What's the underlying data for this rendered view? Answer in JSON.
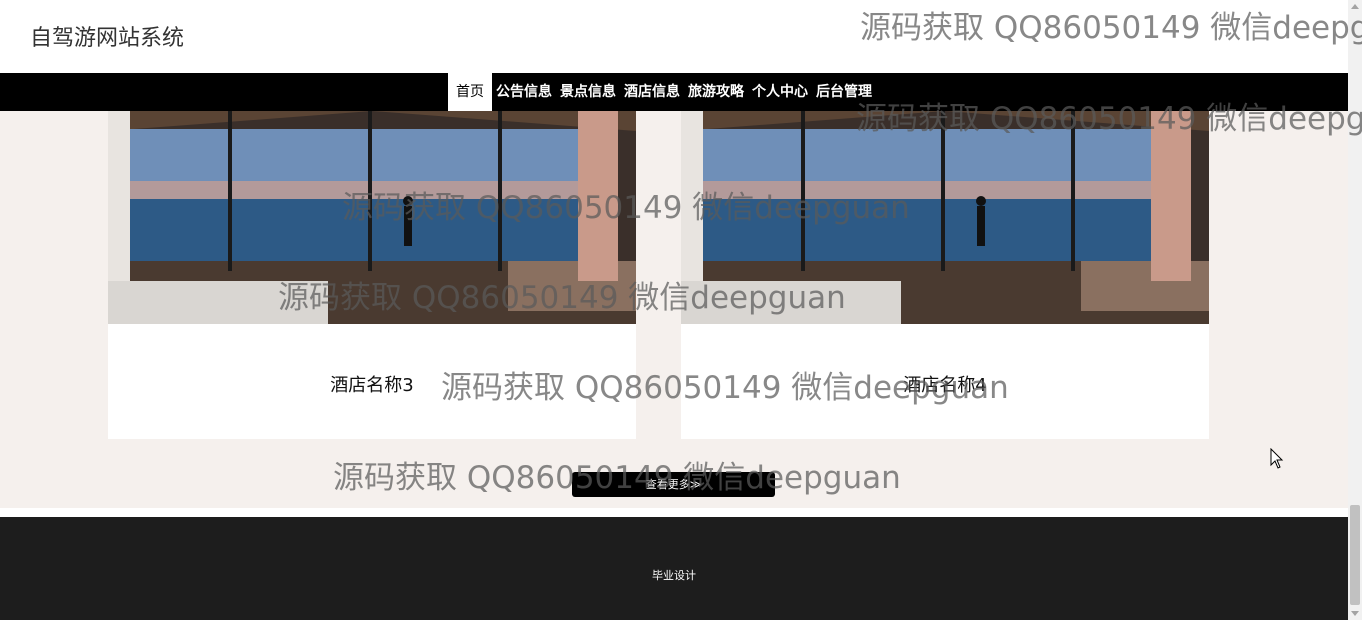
{
  "header": {
    "site_title": "自驾游网站系统"
  },
  "nav": {
    "items": [
      {
        "label": "首页",
        "active": true
      },
      {
        "label": "公告信息"
      },
      {
        "label": "景点信息"
      },
      {
        "label": "酒店信息"
      },
      {
        "label": "旅游攻略"
      },
      {
        "label": "个人中心"
      },
      {
        "label": "后台管理"
      }
    ]
  },
  "hotels": [
    {
      "name": "酒店名称3"
    },
    {
      "name": "酒店名称4"
    }
  ],
  "more_button": {
    "label": "查看更多≫"
  },
  "footer": {
    "text": "毕业设计"
  },
  "watermark": {
    "text": "源码获取 QQ86050149 微信deepguan"
  },
  "colors": {
    "nav_bg": "#000000",
    "footer_bg": "#1d1d1d",
    "page_bg": "#f5f0ed"
  }
}
